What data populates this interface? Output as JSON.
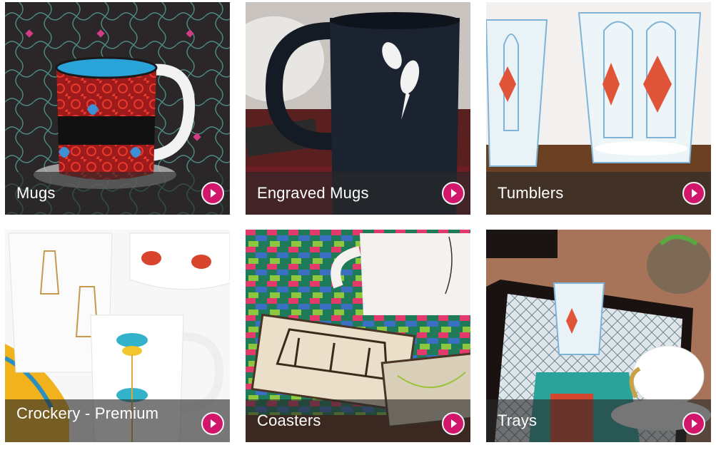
{
  "colors": {
    "accent": "#d1166b",
    "caption_bar": "rgba(40,40,40,0.62)",
    "caption_text": "#ffffff"
  },
  "categories": [
    {
      "label": "Mugs",
      "photo_icon": "mug-photo",
      "arrow_icon": "play-arrow-icon"
    },
    {
      "label": "Engraved Mugs",
      "photo_icon": "engraved-mug-photo",
      "arrow_icon": "play-arrow-icon"
    },
    {
      "label": "Tumblers",
      "photo_icon": "tumblers-photo",
      "arrow_icon": "play-arrow-icon"
    },
    {
      "label": "Crockery - Premium",
      "photo_icon": "crockery-photo",
      "arrow_icon": "play-arrow-icon"
    },
    {
      "label": "Coasters",
      "photo_icon": "coasters-photo",
      "arrow_icon": "play-arrow-icon"
    },
    {
      "label": "Trays",
      "photo_icon": "trays-photo",
      "arrow_icon": "play-arrow-icon"
    }
  ]
}
